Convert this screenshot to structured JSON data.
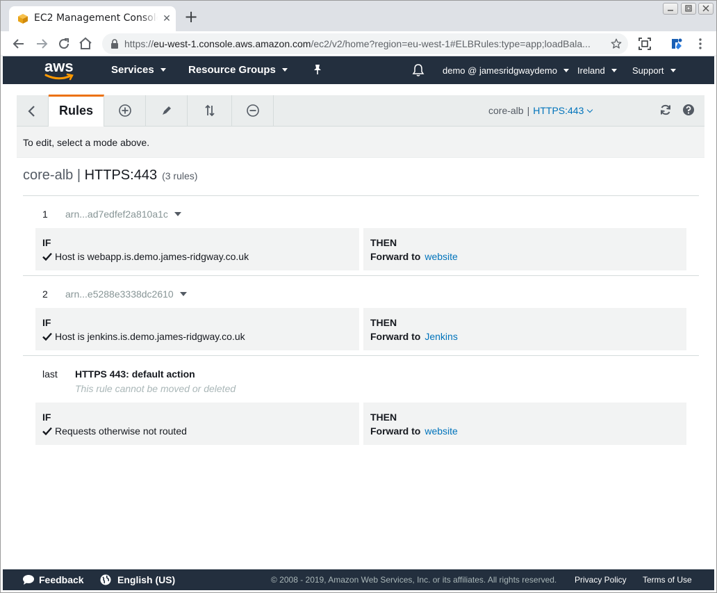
{
  "browser": {
    "tab_title": "EC2 Management Console",
    "url_prefix": "https://",
    "url_host": "eu-west-1.console.aws.amazon.com",
    "url_path": "/ec2/v2/home?region=eu-west-1#ELBRules:type=app;loadBala..."
  },
  "aws_nav": {
    "logo": "aws",
    "services": "Services",
    "resource_groups": "Resource Groups",
    "account": "demo @ jamesridgwaydemo",
    "region": "Ireland",
    "support": "Support"
  },
  "rules_bar": {
    "tab_rules": "Rules",
    "lb_name": "core-alb",
    "separator": "|",
    "listener": "HTTPS:443"
  },
  "mode_hint": "To edit, select a mode above.",
  "page": {
    "lb_name": "core-alb",
    "separator": "|",
    "listener": "HTTPS:443",
    "rule_count": "(3 rules)"
  },
  "rules": [
    {
      "number": "1",
      "arn": "arn...ad7edfef2a810a1c",
      "if_label": "IF",
      "condition": "Host is webapp.is.demo.james-ridgway.co.uk",
      "then_label": "THEN",
      "action_label": "Forward to",
      "target": "website"
    },
    {
      "number": "2",
      "arn": "arn...e5288e3338dc2610",
      "if_label": "IF",
      "condition": "Host is jenkins.is.demo.james-ridgway.co.uk",
      "then_label": "THEN",
      "action_label": "Forward to",
      "target": "Jenkins"
    }
  ],
  "default_rule": {
    "number": "last",
    "title": "HTTPS 443: default action",
    "note": "This rule cannot be moved or deleted",
    "if_label": "IF",
    "condition": "Requests otherwise not routed",
    "then_label": "THEN",
    "action_label": "Forward to",
    "target": "website"
  },
  "footer": {
    "feedback": "Feedback",
    "language": "English (US)",
    "copyright": "© 2008 - 2019, Amazon Web Services, Inc. or its affiliates. All rights reserved.",
    "privacy": "Privacy Policy",
    "terms": "Terms of Use"
  },
  "colors": {
    "aws_nav_bg": "#232f3e",
    "accent_orange": "#ec7211",
    "link_blue": "#0073bb"
  }
}
